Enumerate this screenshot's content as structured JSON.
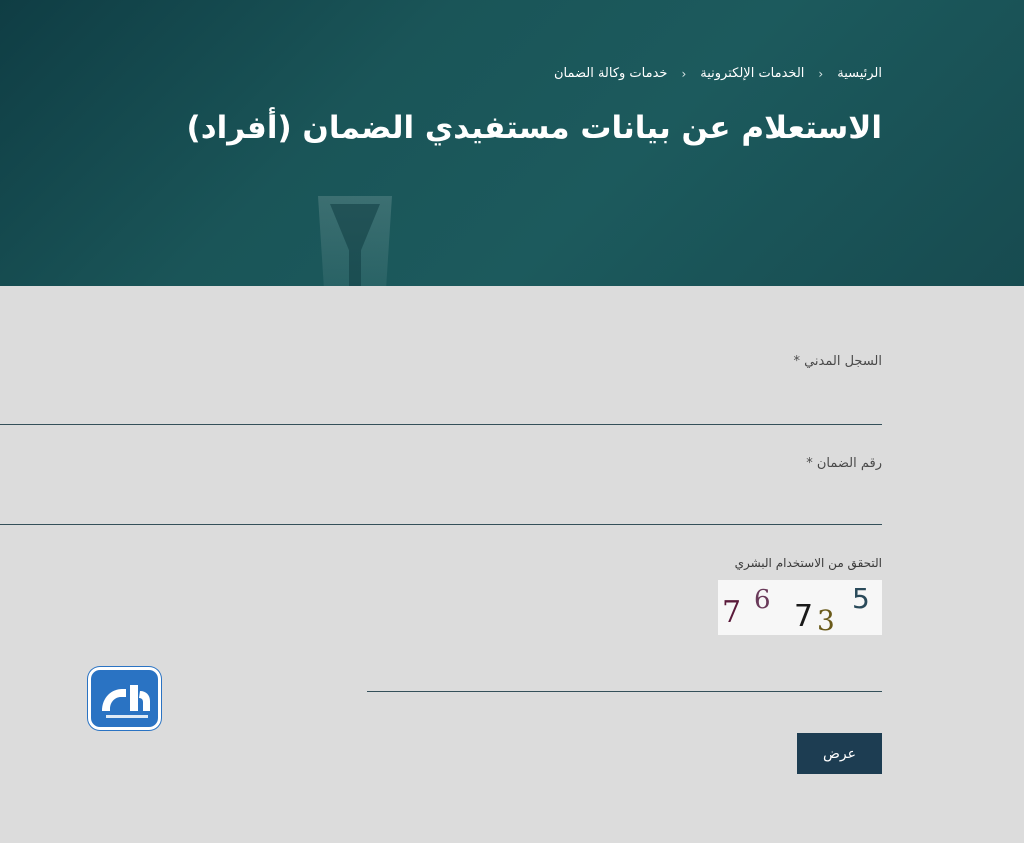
{
  "breadcrumb": {
    "items": [
      "الرئيسية",
      "الخدمات الإلكترونية",
      "خدمات وكالة الضمان"
    ]
  },
  "page": {
    "title": "الاستعلام عن بيانات مستفيدي الضمان (أفراد)"
  },
  "form": {
    "civil_id_label": "السجل المدني *",
    "civil_id_value": "",
    "guarantee_no_label": "رقم الضمان *",
    "guarantee_no_value": "",
    "captcha_label": "التحقق من الاستخدام البشري",
    "captcha_value": "",
    "captcha_image": {
      "digits": [
        "7",
        "6",
        "7",
        "3",
        "5"
      ],
      "colors": [
        "#5a1a3a",
        "#6a3a5a",
        "#1a1a1a",
        "#6a5a1a",
        "#2a4a5a"
      ]
    },
    "submit_label": "عرض"
  },
  "colors": {
    "hero_bg": "#1a5558",
    "submit_bg": "#1d3d52",
    "logo_bg": "#2a73c3"
  },
  "logo": {
    "icon": "almrj3-logo-icon"
  }
}
